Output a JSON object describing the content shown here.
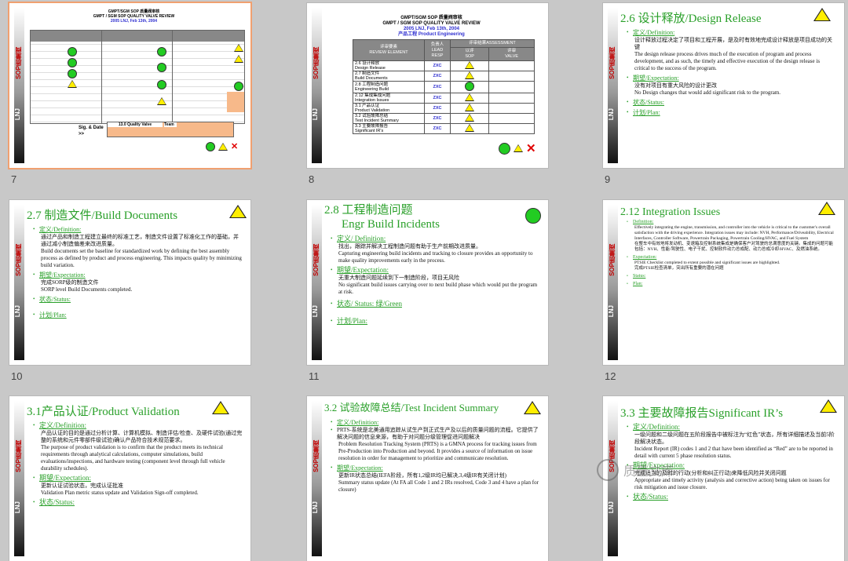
{
  "slides": [
    {
      "number": "7",
      "quality_title": "GMPT/SGM SOP 质量阀审核",
      "quality_subtitle": "GMPT / SGM SOP QUALITY VALVE REVIEW",
      "quality_date": "2005 LNJ, Feb 13th, 2004",
      "sig_label": "Sig. & Date >>",
      "valve_label": "13.0 Quality Valve",
      "team_label": "Team"
    },
    {
      "number": "8",
      "header1": "GMPT/SGM SOP 质量阀审核",
      "header2": "GMPT / SGM SOP QUALITY VALVE REVIEW",
      "header3": "2005 LNJ, Feb 13th, 2004",
      "header4": "产品工程 Product Engineering",
      "col_review": "评审要素\nREVIEW ELEMENT",
      "col_lead": "负责人\nLEAD RESP",
      "col_assess": "评审结果ASSESSMENT",
      "col_sop": "以评\nSOP",
      "col_valve": "评审\nVALVE",
      "rows": [
        {
          "element": "2.6 设计释放\nDesign Release",
          "lead": "ZXC",
          "status": "tri"
        },
        {
          "element": "2.7 制造文件\nBuild Documents",
          "lead": "ZXC",
          "status": "tri"
        },
        {
          "element": "2.8 工程制造问题\nEngineering Build",
          "lead": "ZXC",
          "status": "circ"
        },
        {
          "element": "2.12 集成集成问题\nIntegration Issues",
          "lead": "ZXC",
          "status": "tri"
        },
        {
          "element": "3.1 产品认证\nProduct Validation",
          "lead": "ZXC",
          "status": "tri"
        },
        {
          "element": "3.2 试验故障总结\nTest Incident Summary",
          "lead": "ZXC",
          "status": "tri"
        },
        {
          "element": "3.3 主要故障报告\nSignificant IR's",
          "lead": "ZXC",
          "status": "tri"
        }
      ]
    },
    {
      "number": "9",
      "title": "2.6 设计释放/Design Release",
      "def_label": "定义/Definition:",
      "def_cn": "设计释放过程决定了项目和工程开展，是及时有效地完成设计释放是项目成功的关键",
      "def_en": "The design release process drives much of the execution of program and process development, and as such, the timely and effective execution of the design release is critical to the success of the program.",
      "exp_label": "期望/Expectation:",
      "exp_cn": "没有对项目有重大风险的设计更改",
      "exp_en": "No Design changes that would add significant risk to the program.",
      "status_label": "状态/Status:",
      "plan_label": "计划/Plan:"
    },
    {
      "number": "10",
      "title": "2.7 制造文件/Build Documents",
      "def_label": "定义/Definition:",
      "def_cn": "通过产品和制造工程建立最终的标准工艺，制造文件设置了标准化工作的基础，并通过减小制造偏差来改进质量。",
      "def_en": "Build documents set the baseline for standardized work by defining the best assembly process as defined by product and process engineering.  This impacts quality by minimizing build variation.",
      "exp_label": "期望/Expectation:",
      "exp_cn": "完成SORP级的制造文件",
      "exp_en": "SORP level Build Documents completed.",
      "status_label": "状态/Status:",
      "plan_label": "计划/Plan:"
    },
    {
      "number": "11",
      "title_line1": "2.8 工程制造问题",
      "title_line2": "Engr Build Incidents",
      "def_label": "定义/ Definition:",
      "def_cn": "找出，跟踪并解决工程制造问题有助于生产前期改进质量。",
      "def_en": "Capturing engineering build incidents and tracking to closure provides an opportunity to make quality improvements early in the process.",
      "exp_label": "期望/Expectation:",
      "exp_cn": "无重大制造问题延续到下一制造阶段，项目无风险",
      "exp_en": "No significant build issues carrying over to next build phase which would put the program at risk.",
      "status_label": "状态/ Status: 绿/Green",
      "plan_label": "计划/Plan:"
    },
    {
      "number": "12",
      "title": "2.12  Integration Issues",
      "def_label": "Definition:",
      "def_en": "Effectively integrating the engine, transmission, and controller into the vehicle is critical to the customer's overall satisfaction with the driving experience. Integration issues may include:  NVH, Performance/Driveability, Electrical Interfaces, Controller Software, Powertrain Packaging, Powertrain Cooling/HVAC, and Fuel System",
      "def_cn": "在整车中有效地将发动机、变速箱及控制系统集成是确保客户对驾驶的总满意度的关键。集成的问题可能包括：NVH、性能/驾驶性、电子干扰、控制软件动力总成配、动力总成冷却/HVAC、及燃油系统。",
      "exp_label": "Expectation:",
      "exp_en": "PTSIE Checklist completed to extent possible and significant issues are highlighted.",
      "exp_cn": "完成PTSIE检查清单，突出所有重要的潜在问题",
      "status_label": "Status:",
      "plan_label": "Plan:"
    },
    {
      "number": "13",
      "title": "3.1产品认证/Product Validation",
      "def_label": "定义/Definition:",
      "def_cn": "产品认证的目的是通过分析计算、计算机模拟、制造评估/检查、及硬件试验(通过完整的系统和元件零部件级试验)确认产品符合技术规范要求。",
      "def_en": "The purpose of product validation is to confirm that the product meets its technical requirements through analytical calculations, computer simulations, build evaluations/inspections, and hardware testing (component level through full vehicle durability schedules).",
      "exp_label": "期望/Expectation:",
      "exp_cn": "更新认证试验状态，完成认证批准",
      "exp_en": "Validation Plan metric status update and Validation Sign-off completed.",
      "status_label": "状态/Status:"
    },
    {
      "number": "14",
      "title": "3.2 试验故障总结/Test Incident Summary",
      "def_label": "定义/Definition:",
      "def_cn": "PRTS-系统是北美通用追踪从试生产到正式生产及以后的质量问题的流程。它提供了解决问题的信息来源，有助于对问题分级管理促进问题解决",
      "def_en": "Problem Resolution Tracking System (PRTS) is a GMNA process for tracking issues from Pre-Production  into Production and beyond. It provides a source of information on issue resolution in order for management to prioritize and communicate resolution.",
      "exp_label": "期望/Expectation:",
      "exp_cn": "更新IR状态总结(IEFA阶段，所有1,2级IR均已解决,3,4级IR有关闭计划)",
      "exp_en": "Summary status update (At FA all Code 1 and 2 IRs resolved, Code 3 and 4 have a plan for closure)"
    },
    {
      "number": "15",
      "title": "3.3 主要故障报告Significant IR’s",
      "def_label": "定义/Definition:",
      "def_cn": "一级问题和二级问题在五阶段报告中被标注为“红色”状态，所有详细描述及当前5阶段解决状态。",
      "def_en": "Incident Report (IR) codes 1 and 2 that have been identified as “Red” are to be reported in detail with current 5 phase resolution status.",
      "exp_label": "期望/Expectation:",
      "exp_cn": "完成适当的及时的行动(分析和纠正行动)来降低风险并关闭问题",
      "exp_en": "Appropriate and timely activity (analysis and corrective action) being taken on issues for risk mitigation and issue closure.",
      "status_label": "状态/Status:"
    }
  ],
  "bar_labels": {
    "sop": "SOP质量阀",
    "lnj": "LNJ"
  },
  "watermark": "质量文库"
}
